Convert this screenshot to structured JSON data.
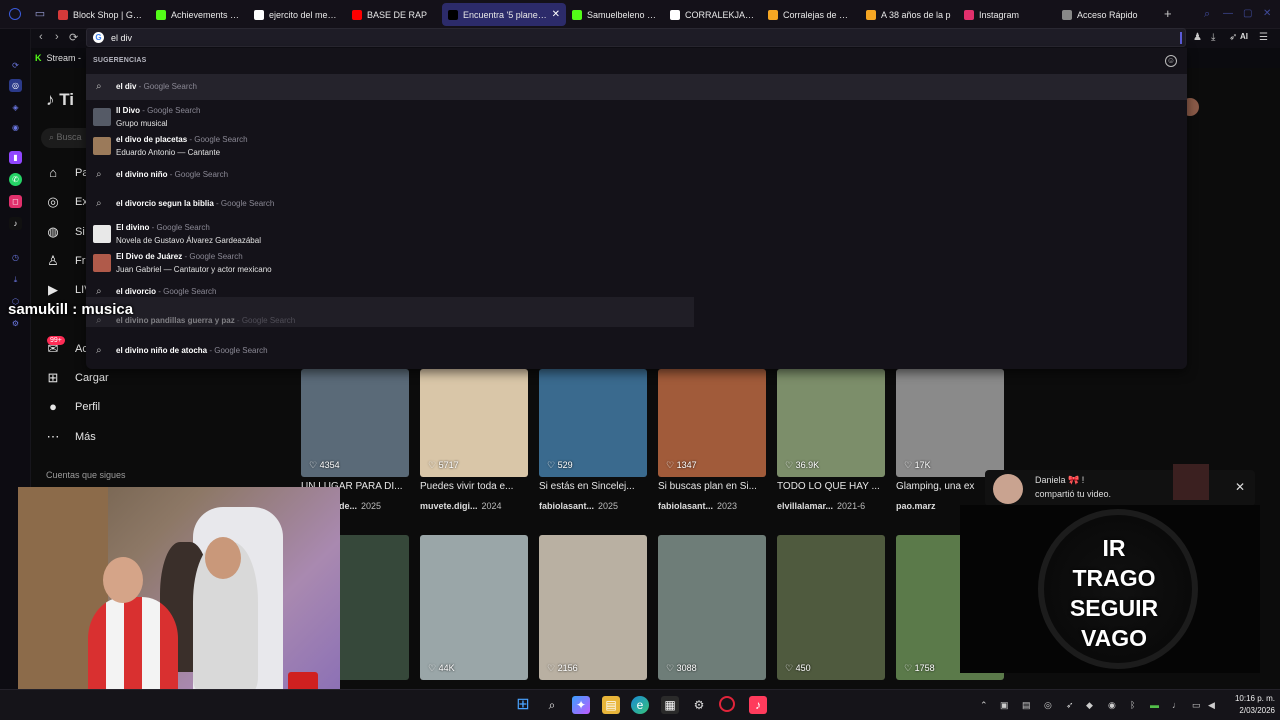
{
  "tabs": [
    {
      "title": "Block Shop | GX Games",
      "color": "#d63a3a",
      "icon": "block-shop-icon"
    },
    {
      "title": "Achievements - Kick",
      "color": "#53fc18",
      "icon": "kick-icon"
    },
    {
      "title": "ejercito del menchi",
      "color": "#ffffff",
      "icon": "google-icon"
    },
    {
      "title": "BASE DE RAP",
      "color": "#ff0000",
      "icon": "youtube-icon"
    },
    {
      "title": "Encuentra '5 planes p",
      "color": "#000000",
      "icon": "tiktok-icon"
    },
    {
      "title": "Samuelbeleno - W",
      "color": "#53fc18",
      "icon": "kick-icon"
    },
    {
      "title": "CORRALEKJAS CU",
      "color": "#ffffff",
      "icon": "google-icon"
    },
    {
      "title": "Corralejas de Sinc",
      "color": "#f5a623",
      "icon": "bookmark-icon"
    },
    {
      "title": "A 38 años de la p",
      "color": "#f5a623",
      "icon": "bookmark-icon"
    },
    {
      "title": "Instagram",
      "color": "#e1306c",
      "icon": "instagram-icon"
    },
    {
      "title": "Acceso Rápido",
      "color": "#888888",
      "icon": "speed-dial-icon"
    }
  ],
  "active_tab_index": 4,
  "omnibox": {
    "value": "el div"
  },
  "bookmarks": {
    "stream": "Stream - "
  },
  "suggestions": {
    "header": "SUGERENCIAS",
    "items": [
      {
        "query": "el div",
        "source": " - Google Search",
        "sub": "",
        "thumb": "search-icon"
      },
      {
        "query": "Il Divo",
        "source": " - Google Search",
        "sub": "Grupo musical",
        "thumb": "il-divo-thumb"
      },
      {
        "query": "el divo de placetas",
        "source": " - Google Search",
        "sub": "Eduardo Antonio — Cantante",
        "thumb": "eduardo-antonio-thumb"
      },
      {
        "query": "el divino niño",
        "source": " - Google Search",
        "sub": "",
        "thumb": "search-icon"
      },
      {
        "query": "el divorcio segun la biblia",
        "source": " - Google Search",
        "sub": "",
        "thumb": "search-icon"
      },
      {
        "query": "El divino",
        "source": " - Google Search",
        "sub": "Novela de Gustavo Álvarez Gardeazábal",
        "thumb": "book-thumb"
      },
      {
        "query": "El Divo de Juárez",
        "source": " - Google Search",
        "sub": "Juan Gabriel — Cantautor y actor mexicano",
        "thumb": "juan-gabriel-thumb"
      },
      {
        "query": "el divorcio",
        "source": " - Google Search",
        "sub": "",
        "thumb": "search-icon"
      },
      {
        "query": "el divino pandillas guerra y paz",
        "source": " - Google Search",
        "sub": "",
        "thumb": "search-icon"
      },
      {
        "query": "el divino niño de atocha",
        "source": " - Google Search",
        "sub": "",
        "thumb": "search-icon"
      }
    ]
  },
  "sidebar": {
    "items": [
      {
        "label": "Pa",
        "icon": "home-icon"
      },
      {
        "label": "Ex",
        "icon": "compass-icon"
      },
      {
        "label": "Si",
        "icon": "following-icon"
      },
      {
        "label": "Fri",
        "icon": "friends-icon"
      },
      {
        "label": "LIV",
        "icon": "live-icon"
      },
      {
        "label": "Ac",
        "icon": "activity-icon"
      },
      {
        "label": "Cargar",
        "icon": "upload-icon"
      },
      {
        "label": "Perfil",
        "icon": "profile-icon"
      },
      {
        "label": "Más",
        "icon": "more-icon"
      }
    ],
    "following_header": "Cuentas que sigues",
    "badge": "99+"
  },
  "videos_row1": [
    {
      "views": "4354",
      "caption": "UN LUGAR PARA DI...",
      "meta_user": "villalamade...",
      "meta_date": "2025",
      "color": "#5a6a78"
    },
    {
      "views": "5717",
      "caption": "Puedes vivir toda e...",
      "meta_user": "muvete.digi...",
      "meta_date": "2024",
      "color": "#d9c6a8"
    },
    {
      "views": "529",
      "caption": "Si estás en Sincelej...",
      "meta_user": "fabiolasant...",
      "meta_date": "2025",
      "color": "#3a6a8e"
    },
    {
      "views": "1347",
      "caption": "Si buscas plan en Si...",
      "meta_user": "fabiolasant...",
      "meta_date": "2023",
      "color": "#a15b3a"
    },
    {
      "views": "36.9K",
      "caption": "TODO LO QUE HAY ...",
      "meta_user": "elvillalamar...",
      "meta_date": "2021-6",
      "color": "#7c8e6a"
    },
    {
      "views": "17K",
      "caption": "Glamping, una ex",
      "meta_user": "pao.marz",
      "meta_date": "",
      "color": "#8a8a8a"
    }
  ],
  "videos_row2": [
    {
      "views": "37",
      "color": "#36483a"
    },
    {
      "views": "44K",
      "color": "#9aa6a8"
    },
    {
      "views": "2156",
      "color": "#b9b0a2"
    },
    {
      "views": "3088",
      "color": "#6e7d78"
    },
    {
      "views": "450",
      "color": "#4f5a3e"
    },
    {
      "views": "1758",
      "color": "#5b7a4a"
    }
  ],
  "chat": {
    "user": "samukill",
    "message": "musica"
  },
  "notification": {
    "name": "Daniela 🎀 !",
    "text": "compartió tu video."
  },
  "clock_overlay": {
    "lines": [
      "IR",
      "TRAGO",
      "SEGUIR",
      "VAGO"
    ]
  },
  "taskbar": {
    "time": "10:16 p. m.",
    "date": "2/03/2026"
  }
}
